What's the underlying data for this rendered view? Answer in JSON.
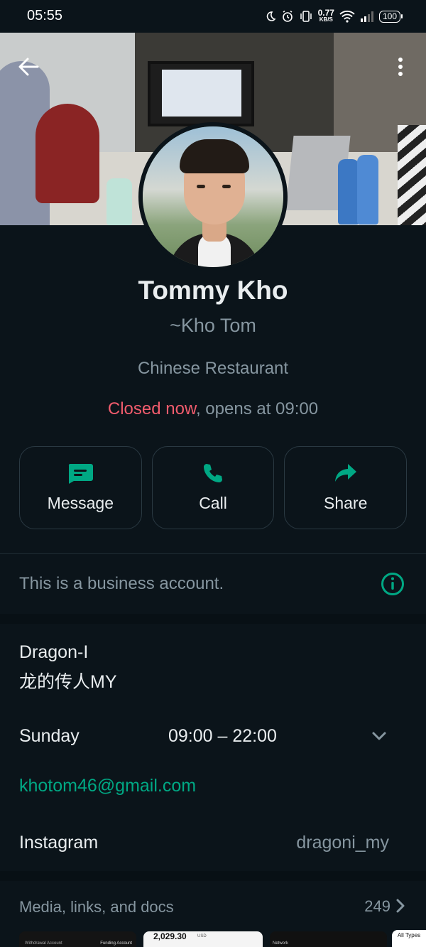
{
  "status_bar": {
    "time": "05:55",
    "net_speed_value": "0.77",
    "net_speed_unit": "KB/S",
    "battery": "100"
  },
  "header": {
    "back_icon": "arrow-left-icon",
    "menu_icon": "more-vertical-icon"
  },
  "profile": {
    "name": "Tommy Kho",
    "subname": "~Kho Tom",
    "category": "Chinese Restaurant",
    "status_closed": "Closed now",
    "status_rest": ", opens at 09:00"
  },
  "actions": [
    {
      "label": "Message",
      "icon": "message-icon"
    },
    {
      "label": "Call",
      "icon": "phone-icon"
    },
    {
      "label": "Share",
      "icon": "share-icon"
    }
  ],
  "business_notice": "This is a business account.",
  "details": {
    "description_line1": "Dragon-I",
    "description_line2": "龙的传人MY",
    "hours_day": "Sunday",
    "hours_range": "09:00 – 22:00",
    "email": "khotom46@gmail.com",
    "instagram_label": "Instagram",
    "instagram_handle": "dragoni_my"
  },
  "media": {
    "title": "Media, links, and docs",
    "count": "249",
    "thumb1_left": "Withdrawal Account",
    "thumb1_right": "Funding Account",
    "thumb2_amount": "2,029.30",
    "thumb2_unit": "USD",
    "thumb3_text": "Network",
    "overlay_pill": "All Types"
  },
  "colors": {
    "accent": "#00a884",
    "closed": "#f15c6d",
    "background": "#0b141a",
    "muted_text": "#8696a0"
  }
}
